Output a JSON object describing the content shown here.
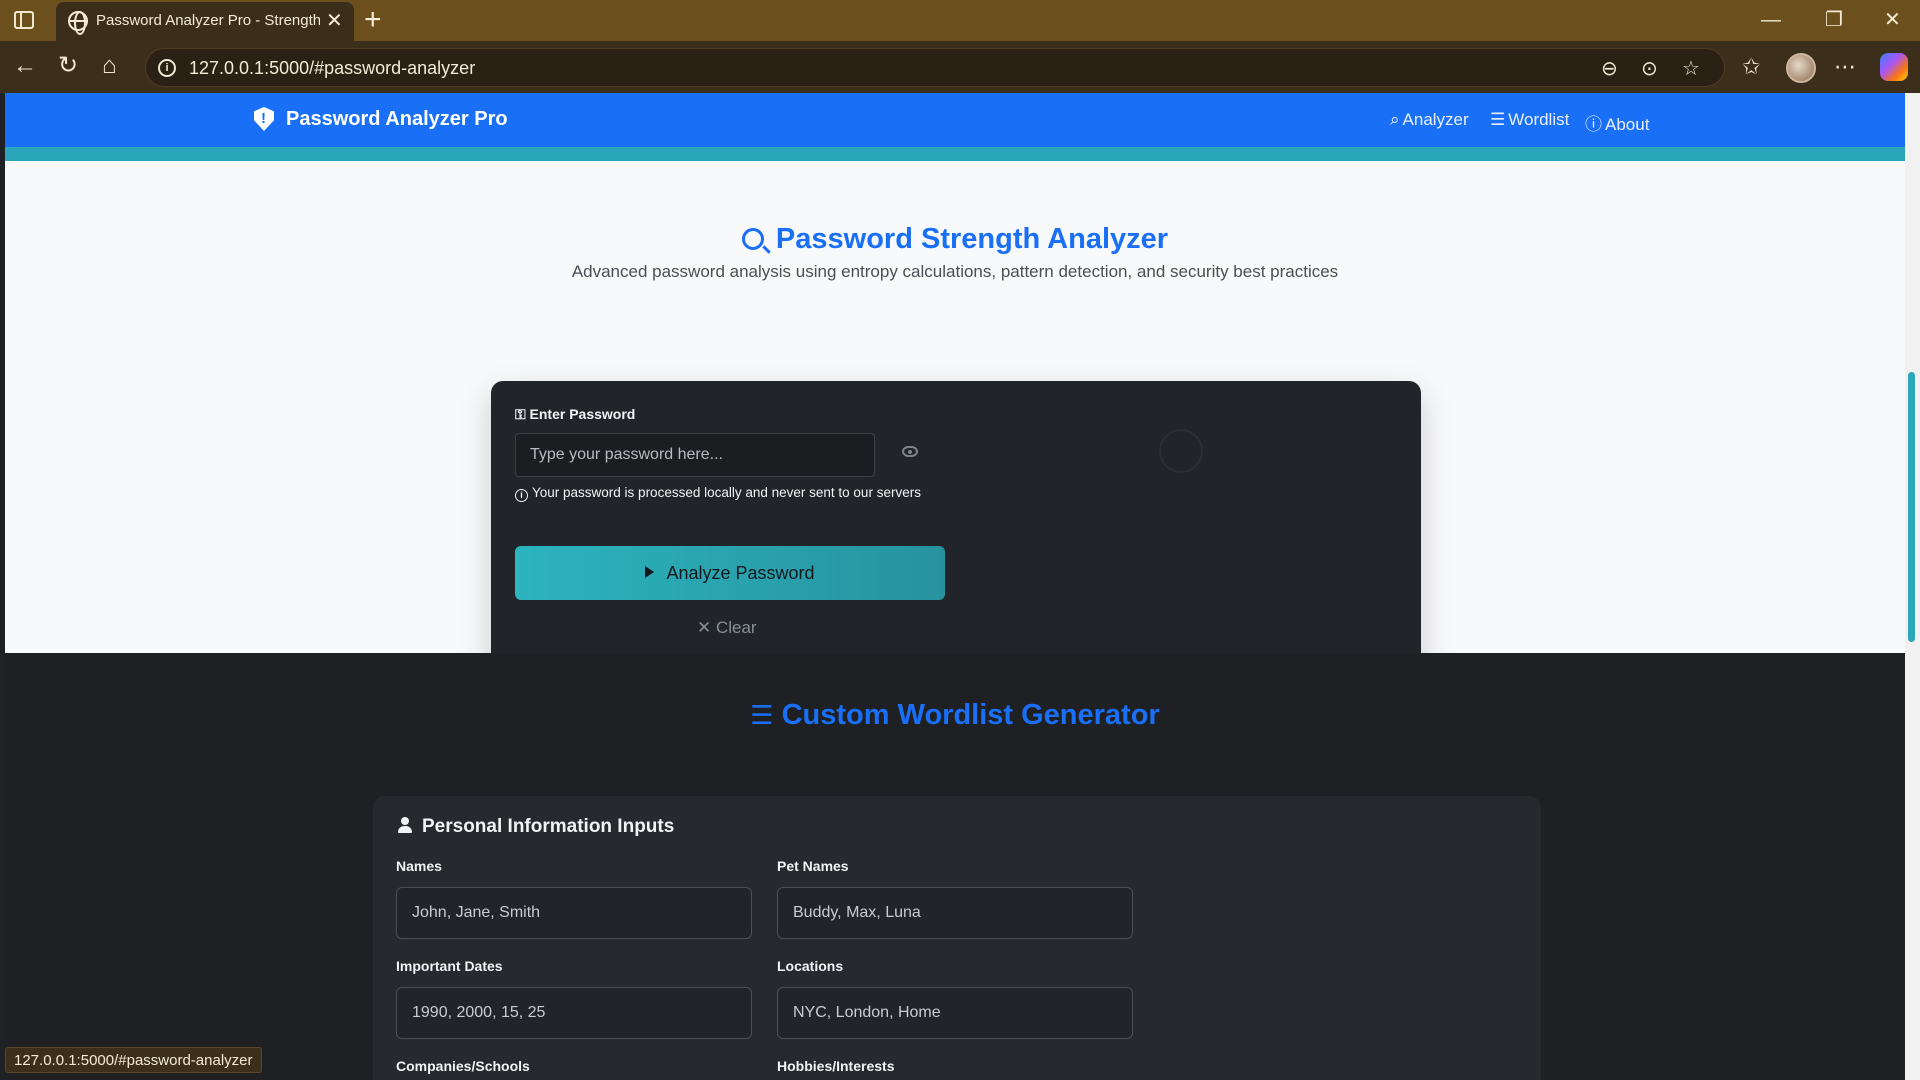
{
  "browser": {
    "tab_title": "Password Analyzer Pro - Strength",
    "url": "127.0.0.1:5000/#password-analyzer",
    "status_url": "127.0.0.1:5000/#password-analyzer"
  },
  "navbar": {
    "brand": "Password Analyzer Pro",
    "links": [
      {
        "label": "Analyzer",
        "icon": "search-icon"
      },
      {
        "label": "Wordlist",
        "icon": "list-icon"
      },
      {
        "label": "About",
        "icon": "info-icon"
      }
    ]
  },
  "hero": {
    "title": "Password Strength Analyzer",
    "subtitle": "Advanced password analysis using entropy calculations, pattern detection, and security best practices"
  },
  "analyzer": {
    "label": "Enter Password",
    "label_icon": "key-icon",
    "placeholder": "Type your password here...",
    "note": "Your password is processed locally and never sent to our servers",
    "analyze_label": "Analyze Password",
    "clear_label": "Clear"
  },
  "wordlist": {
    "title": "Custom Wordlist Generator",
    "card_title": "Personal Information Inputs",
    "fields": [
      {
        "label": "Names",
        "placeholder": "John, Jane, Smith"
      },
      {
        "label": "Pet Names",
        "placeholder": "Buddy, Max, Luna"
      },
      {
        "label": "Important Dates",
        "placeholder": "1990, 2000, 15, 25"
      },
      {
        "label": "Locations",
        "placeholder": "NYC, London, Home"
      },
      {
        "label": "Companies/Schools",
        "placeholder": ""
      },
      {
        "label": "Hobbies/Interests",
        "placeholder": ""
      }
    ]
  },
  "colors": {
    "primary": "#1a6ff7",
    "accent": "#2aa7b8",
    "card_dark": "#212529",
    "browser_frame": "#6b4f1d"
  }
}
